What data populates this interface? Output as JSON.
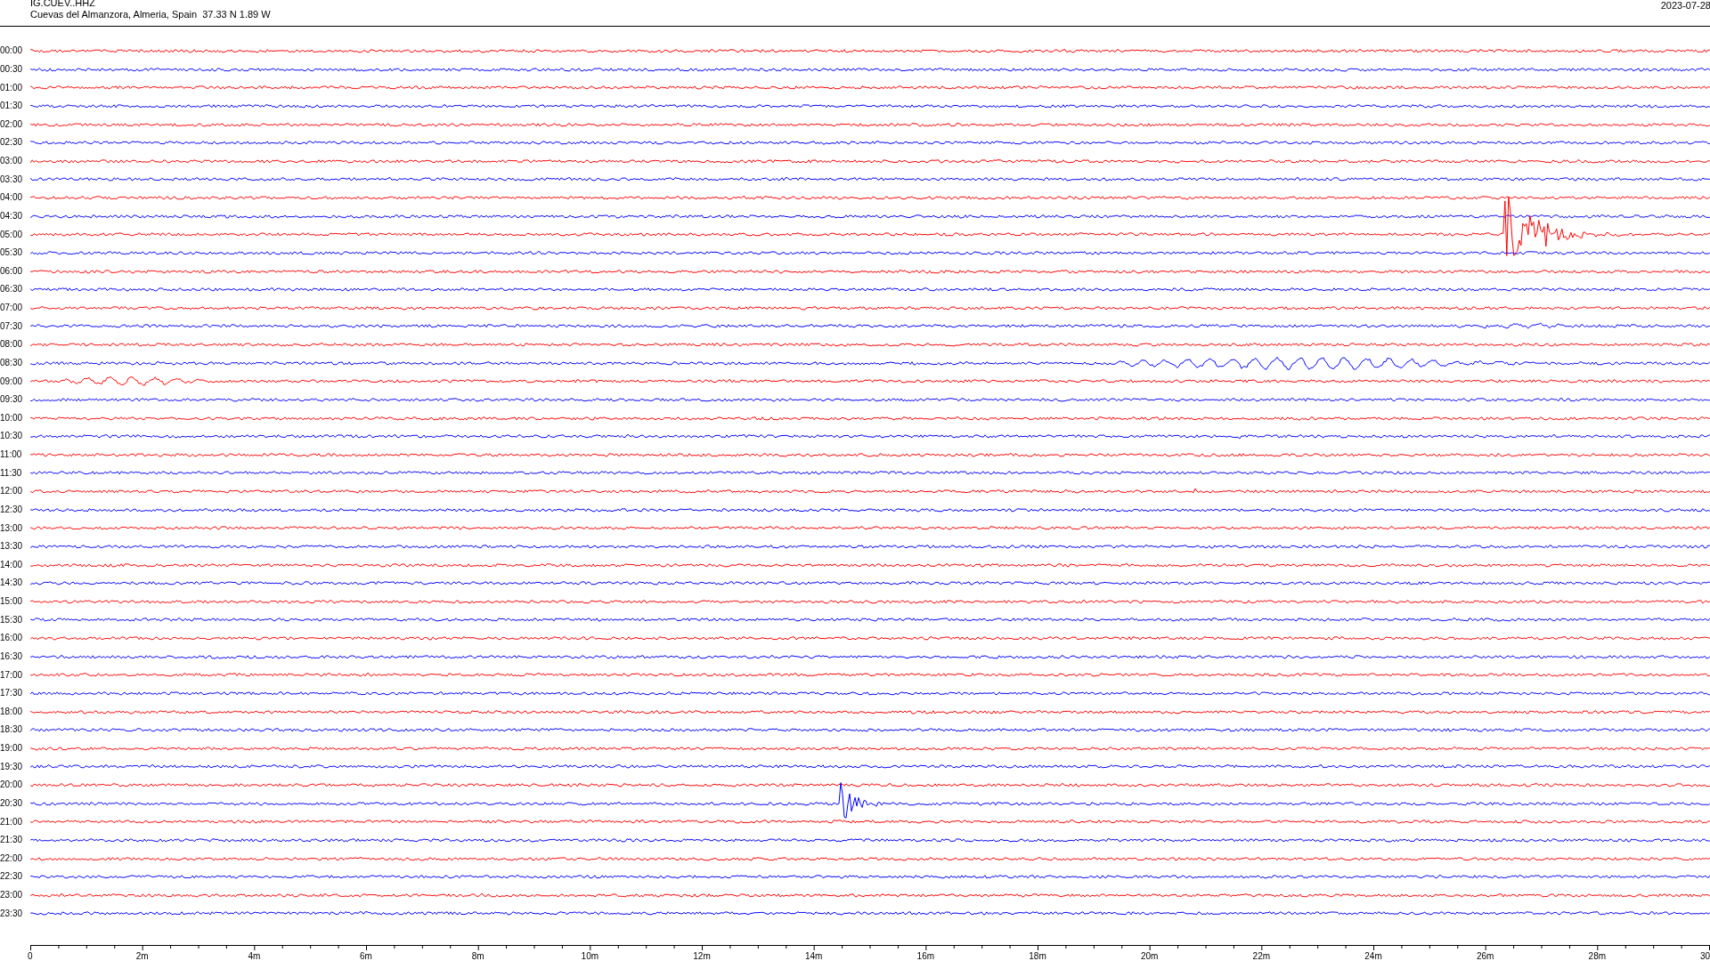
{
  "header": {
    "station": "IG.CUEV..HHZ",
    "location": "Cuevas del Almanzora, Almeria, Spain  37.33 N 1.89 W",
    "date": "2023-07-28"
  },
  "rows": [
    {
      "label": "00:00",
      "color": "#ff0000"
    },
    {
      "label": "00:30",
      "color": "#0000ff"
    },
    {
      "label": "01:00",
      "color": "#ff0000"
    },
    {
      "label": "01:30",
      "color": "#0000ff"
    },
    {
      "label": "02:00",
      "color": "#ff0000"
    },
    {
      "label": "02:30",
      "color": "#0000ff"
    },
    {
      "label": "03:00",
      "color": "#ff0000"
    },
    {
      "label": "03:30",
      "color": "#0000ff"
    },
    {
      "label": "04:00",
      "color": "#ff0000"
    },
    {
      "label": "04:30",
      "color": "#0000ff"
    },
    {
      "label": "05:00",
      "color": "#ff0000"
    },
    {
      "label": "05:30",
      "color": "#0000ff"
    },
    {
      "label": "06:00",
      "color": "#ff0000"
    },
    {
      "label": "06:30",
      "color": "#0000ff"
    },
    {
      "label": "07:00",
      "color": "#ff0000"
    },
    {
      "label": "07:30",
      "color": "#0000ff"
    },
    {
      "label": "08:00",
      "color": "#ff0000"
    },
    {
      "label": "08:30",
      "color": "#0000ff"
    },
    {
      "label": "09:00",
      "color": "#ff0000"
    },
    {
      "label": "09:30",
      "color": "#0000ff"
    },
    {
      "label": "10:00",
      "color": "#ff0000"
    },
    {
      "label": "10:30",
      "color": "#0000ff"
    },
    {
      "label": "11:00",
      "color": "#ff0000"
    },
    {
      "label": "11:30",
      "color": "#0000ff"
    },
    {
      "label": "12:00",
      "color": "#ff0000"
    },
    {
      "label": "12:30",
      "color": "#0000ff"
    },
    {
      "label": "13:00",
      "color": "#ff0000"
    },
    {
      "label": "13:30",
      "color": "#0000ff"
    },
    {
      "label": "14:00",
      "color": "#ff0000"
    },
    {
      "label": "14:30",
      "color": "#0000ff"
    },
    {
      "label": "15:00",
      "color": "#ff0000"
    },
    {
      "label": "15:30",
      "color": "#0000ff"
    },
    {
      "label": "16:00",
      "color": "#ff0000"
    },
    {
      "label": "16:30",
      "color": "#0000ff"
    },
    {
      "label": "17:00",
      "color": "#ff0000"
    },
    {
      "label": "17:30",
      "color": "#0000ff"
    },
    {
      "label": "18:00",
      "color": "#ff0000"
    },
    {
      "label": "18:30",
      "color": "#0000ff"
    },
    {
      "label": "19:00",
      "color": "#ff0000"
    },
    {
      "label": "19:30",
      "color": "#0000ff"
    },
    {
      "label": "20:00",
      "color": "#ff0000"
    },
    {
      "label": "20:30",
      "color": "#0000ff"
    },
    {
      "label": "21:00",
      "color": "#ff0000"
    },
    {
      "label": "21:30",
      "color": "#0000ff"
    },
    {
      "label": "22:00",
      "color": "#ff0000"
    },
    {
      "label": "22:30",
      "color": "#0000ff"
    },
    {
      "label": "23:00",
      "color": "#ff0000"
    },
    {
      "label": "23:30",
      "color": "#0000ff"
    }
  ],
  "time_axis": {
    "labels": [
      "0",
      "2m",
      "4m",
      "6m",
      "8m",
      "10m",
      "12m",
      "14m",
      "16m",
      "18m",
      "20m",
      "22m",
      "24m",
      "26m",
      "28m",
      "30"
    ]
  }
}
